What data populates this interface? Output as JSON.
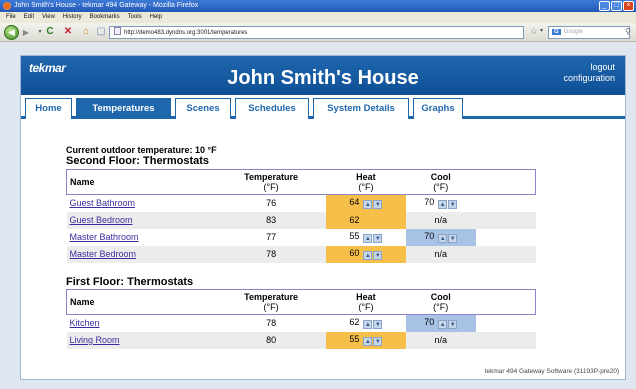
{
  "window": {
    "title": "John Smith's House - tekmar 494 Gateway - Mozilla Firefox",
    "menu": [
      "File",
      "Edit",
      "View",
      "History",
      "Bookmarks",
      "Tools",
      "Help"
    ]
  },
  "toolbar": {
    "url": "http://demo483.dyndns.org:3001/temperatures",
    "search_placeholder": "Google",
    "search_engine": "G"
  },
  "header": {
    "brand": "tekmar",
    "title": "John Smith's House",
    "links": [
      "logout",
      "configuration"
    ]
  },
  "tabs": [
    {
      "label": "Home",
      "active": false
    },
    {
      "label": "Temperatures",
      "active": true
    },
    {
      "label": "Scenes",
      "active": false
    },
    {
      "label": "Schedules",
      "active": false
    },
    {
      "label": "System Details",
      "active": false
    },
    {
      "label": "Graphs",
      "active": false
    }
  ],
  "outdoor_text": "Current outdoor temperature: 10 °F",
  "columns": {
    "name": "Name",
    "temperature": "Temperature",
    "heat": "Heat",
    "cool": "Cool",
    "unit": "(°F)"
  },
  "sections": [
    {
      "title": "Second Floor: Thermostats",
      "rows": [
        {
          "name": "Guest Bathroom",
          "temperature": "76",
          "heat": "64",
          "heat_active": true,
          "cool": "70",
          "cool_active": false
        },
        {
          "name": "Guest Bedroom",
          "temperature": "83",
          "heat": "62",
          "heat_active": true,
          "cool": "n/a",
          "cool_active": false
        },
        {
          "name": "Master Bathroom",
          "temperature": "77",
          "heat": "55",
          "heat_active": false,
          "cool": "70",
          "cool_active": true
        },
        {
          "name": "Master Bedroom",
          "temperature": "78",
          "heat": "60",
          "heat_active": true,
          "cool": "n/a",
          "cool_active": false
        }
      ]
    },
    {
      "title": "First Floor: Thermostats",
      "rows": [
        {
          "name": "Kitchen",
          "temperature": "78",
          "heat": "62",
          "heat_active": false,
          "cool": "70",
          "cool_active": true
        },
        {
          "name": "Living Room",
          "temperature": "80",
          "heat": "55",
          "heat_active": true,
          "cool": "n/a",
          "cool_active": false
        }
      ]
    }
  ],
  "footer": "tekmar 494 Gateway Software (31193P-pre20)",
  "colors": {
    "banner": "#1f67ad",
    "heat_active": "#f6bf4a",
    "cool_active": "#a8c2e6",
    "link": "#3a2ea0"
  }
}
